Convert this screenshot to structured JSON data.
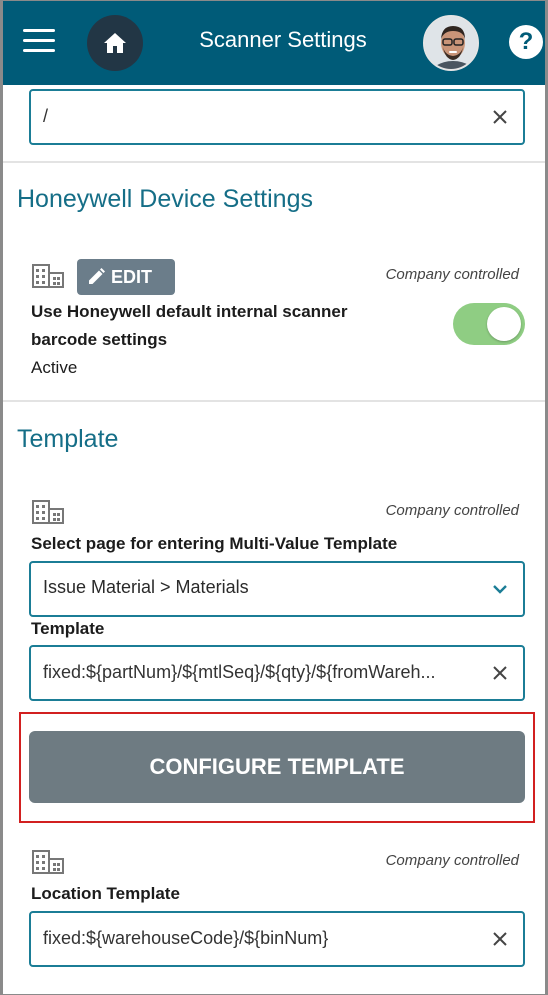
{
  "header": {
    "title": "Scanner Settings",
    "bg_color": "#005b78",
    "help_glyph": "?"
  },
  "top_field": {
    "value": "/"
  },
  "honeywell": {
    "heading": "Honeywell Device Settings",
    "edit_label": "EDIT",
    "company_controlled": "Company controlled",
    "setting_label": "Use Honeywell default internal scanner barcode settings",
    "status": "Active",
    "toggle_on": true,
    "toggle_color": "#8fcd83"
  },
  "template": {
    "heading": "Template",
    "company_controlled": "Company controlled",
    "select_label": "Select page for entering Multi-Value Template",
    "select_value": "Issue Material > Materials",
    "template_label": "Template",
    "template_value": "fixed:${partNum}/${mtlSeq}/${qty}/${fromWareh...",
    "configure_button": "CONFIGURE TEMPLATE",
    "highlight_color": "#d22020"
  },
  "location": {
    "company_controlled": "Company controlled",
    "label": "Location Template",
    "value": "fixed:${warehouseCode}/${binNum}"
  }
}
